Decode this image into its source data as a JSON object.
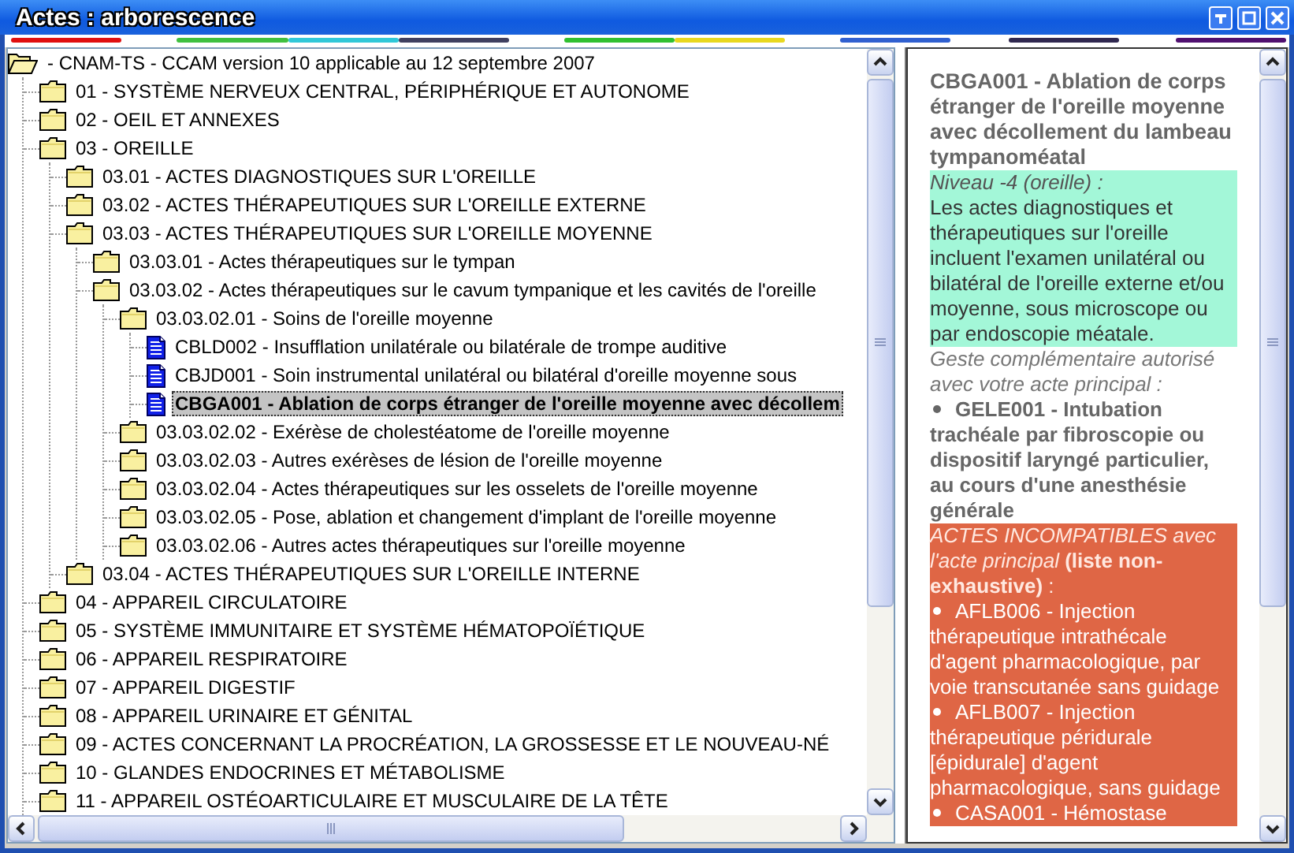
{
  "window": {
    "title": "Actes : arborescence"
  },
  "tree": [
    {
      "kind": "open_folder",
      "label": "- CNAM-TS - CCAM version 10 applicable au 12 septembre 2007",
      "selected": false,
      "children": [
        {
          "kind": "folder",
          "label": "01 - SYSTÈME NERVEUX CENTRAL, PÉRIPHÉRIQUE ET AUTONOME",
          "selected": false
        },
        {
          "kind": "folder",
          "label": "02 - OEIL ET ANNEXES",
          "selected": false
        },
        {
          "kind": "folder",
          "label": "03 - OREILLE",
          "selected": false,
          "children": [
            {
              "kind": "folder",
              "label": "03.01 - ACTES DIAGNOSTIQUES SUR L'OREILLE",
              "selected": false
            },
            {
              "kind": "folder",
              "label": "03.02 - ACTES THÉRAPEUTIQUES SUR L'OREILLE EXTERNE",
              "selected": false
            },
            {
              "kind": "folder",
              "label": "03.03 - ACTES THÉRAPEUTIQUES SUR L'OREILLE MOYENNE",
              "selected": false,
              "children": [
                {
                  "kind": "folder",
                  "label": "03.03.01 - Actes thérapeutiques sur le tympan",
                  "selected": false
                },
                {
                  "kind": "folder",
                  "label": "03.03.02 - Actes thérapeutiques sur le cavum tympanique et les cavités de l'oreille",
                  "selected": false,
                  "children": [
                    {
                      "kind": "folder",
                      "label": "03.03.02.01 - Soins de l'oreille moyenne",
                      "selected": false,
                      "children": [
                        {
                          "kind": "document",
                          "label": "CBLD002 - Insufflation unilatérale ou bilatérale de trompe auditive",
                          "selected": false
                        },
                        {
                          "kind": "document",
                          "label": "CBJD001 - Soin instrumental unilatéral ou bilatéral d'oreille moyenne sous",
                          "selected": false
                        },
                        {
                          "kind": "document",
                          "label": "CBGA001 - Ablation de corps étranger de l'oreille moyenne avec décollem",
                          "selected": true
                        }
                      ]
                    },
                    {
                      "kind": "folder",
                      "label": "03.03.02.02 - Exérèse de cholestéatome de l'oreille moyenne",
                      "selected": false
                    },
                    {
                      "kind": "folder",
                      "label": "03.03.02.03 - Autres exérèses de lésion de l'oreille moyenne",
                      "selected": false
                    },
                    {
                      "kind": "folder",
                      "label": "03.03.02.04 - Actes thérapeutiques sur les osselets de l'oreille moyenne",
                      "selected": false
                    },
                    {
                      "kind": "folder",
                      "label": "03.03.02.05 - Pose, ablation et changement d'implant de l'oreille moyenne",
                      "selected": false
                    },
                    {
                      "kind": "folder",
                      "label": "03.03.02.06 - Autres actes thérapeutiques sur l'oreille moyenne",
                      "selected": false
                    }
                  ]
                }
              ]
            },
            {
              "kind": "folder",
              "label": "03.04 - ACTES THÉRAPEUTIQUES SUR L'OREILLE INTERNE",
              "selected": false
            }
          ]
        },
        {
          "kind": "folder",
          "label": "04 - APPAREIL CIRCULATOIRE",
          "selected": false
        },
        {
          "kind": "folder",
          "label": "05 - SYSTÈME IMMUNITAIRE ET SYSTÈME HÉMATOPOÏÉTIQUE",
          "selected": false
        },
        {
          "kind": "folder",
          "label": "06 - APPAREIL RESPIRATOIRE",
          "selected": false
        },
        {
          "kind": "folder",
          "label": "07 - APPAREIL DIGESTIF",
          "selected": false
        },
        {
          "kind": "folder",
          "label": "08 - APPAREIL URINAIRE ET GÉNITAL",
          "selected": false
        },
        {
          "kind": "folder",
          "label": "09 - ACTES CONCERNANT LA PROCRÉATION, LA GROSSESSE ET LE NOUVEAU-NÉ",
          "selected": false
        },
        {
          "kind": "folder",
          "label": "10 - GLANDES ENDOCRINES ET MÉTABOLISME",
          "selected": false
        },
        {
          "kind": "folder",
          "label": "11 - APPAREIL OSTÉOARTICULAIRE ET MUSCULAIRE DE LA TÊTE",
          "selected": false
        }
      ]
    }
  ],
  "detail": {
    "title": "CBGA001 - Ablation de corps étranger de l'oreille moyenne avec décollement du lambeau tympanoméatal",
    "sections": [
      {
        "kind": "level",
        "heading": "Niveau -4 (oreille) :",
        "text": "Les actes diagnostiques et thérapeutiques sur l'oreille incluent l'examen unilatéral ou bilatéral de l'oreille externe et/ou moyenne, sous microscope ou par endoscopie méatale."
      },
      {
        "kind": "complementary",
        "heading": "Geste complémentaire autorisé avec votre acte principal :",
        "items": [
          "GELE001 - Intubation trachéale par fibroscopie ou dispositif laryngé particulier, au cours d'une anesthésie générale"
        ]
      },
      {
        "kind": "incompatible",
        "heading": "*ACTES INCOMPATIBLES avec l'acte principal* **(liste non-exhaustive)** :",
        "items": [
          "AFLB006 - Injection thérapeutique intrathécale d'agent pharmacologique, par voie transcutanée sans guidage",
          "AFLB007 - Injection thérapeutique péridurale [épidurale] d'agent pharmacologique, sans guidage",
          "CASA001 - Hémostase"
        ]
      }
    ]
  }
}
